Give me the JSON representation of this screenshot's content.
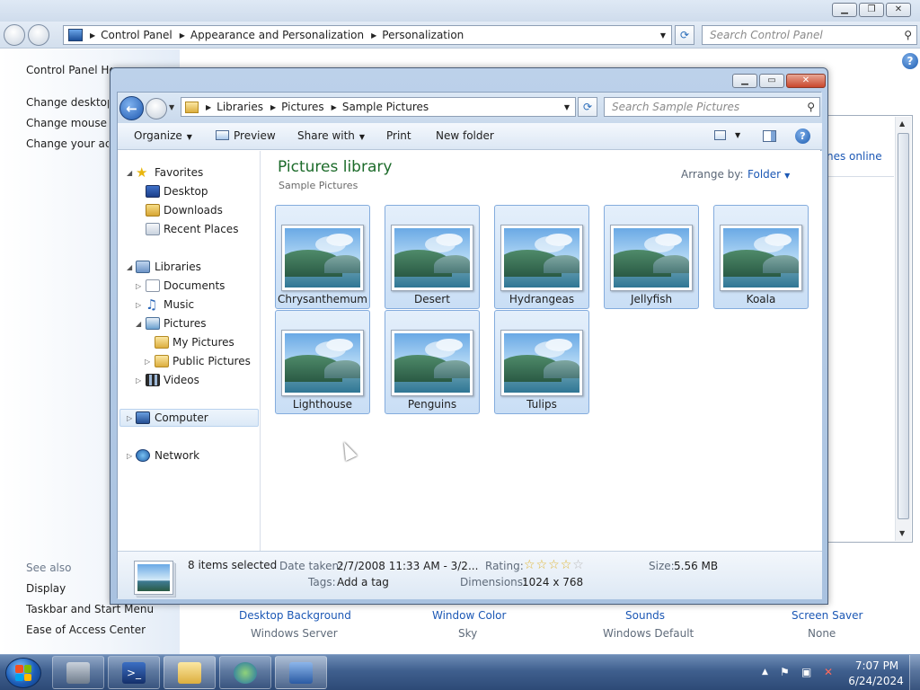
{
  "control_panel": {
    "breadcrumbs": [
      "Control Panel",
      "Appearance and Personalization",
      "Personalization"
    ],
    "search_placeholder": "Search Control Panel",
    "left_links": [
      "Control Panel Home",
      "Change desktop icons",
      "Change mouse pointers",
      "Change your account picture"
    ],
    "see_also_label": "See also",
    "see_also": [
      "Display",
      "Taskbar and Start Menu",
      "Ease of Access Center"
    ],
    "online_link": "nes online",
    "theme_items": [
      {
        "label": "Desktop Background",
        "value": "Windows Server"
      },
      {
        "label": "Window Color",
        "value": "Sky"
      },
      {
        "label": "Sounds",
        "value": "Windows Default"
      },
      {
        "label": "Screen Saver",
        "value": "None"
      }
    ]
  },
  "explorer": {
    "breadcrumbs": [
      "Libraries",
      "Pictures",
      "Sample Pictures"
    ],
    "search_placeholder": "Search Sample Pictures",
    "toolbar": {
      "organize": "Organize",
      "preview": "Preview",
      "share_with": "Share with",
      "print": "Print",
      "new_folder": "New folder"
    },
    "tree": {
      "favorites": {
        "label": "Favorites",
        "items": [
          "Desktop",
          "Downloads",
          "Recent Places"
        ]
      },
      "libraries": {
        "label": "Libraries",
        "items": [
          "Documents",
          "Music",
          "Pictures"
        ]
      },
      "pictures_children": [
        "My Pictures",
        "Public Pictures"
      ],
      "videos": "Videos",
      "computer": "Computer",
      "network": "Network"
    },
    "library_title": "Pictures library",
    "library_subtitle": "Sample Pictures",
    "arrange_by_label": "Arrange by:",
    "arrange_by_value": "Folder",
    "files": [
      "Chrysanthemum",
      "Desert",
      "Hydrangeas",
      "Jellyfish",
      "Koala",
      "Lighthouse",
      "Penguins",
      "Tulips"
    ],
    "details": {
      "selection": "8 items selected",
      "date_taken_label": "Date taken:",
      "date_taken_value": "2/7/2008 11:33 AM - 3/2...",
      "tags_label": "Tags:",
      "tags_value": "Add a tag",
      "rating_label": "Rating:",
      "rating_stars": 0,
      "dimensions_label": "Dimensions:",
      "dimensions_value": "1024 x 768",
      "size_label": "Size:",
      "size_value": "5.56 MB"
    }
  },
  "taskbar": {
    "time": "7:07 PM",
    "date": "6/24/2024"
  },
  "colors": {
    "link": "#1c58b5",
    "library_title": "#1c6b2a",
    "selection": "#c9def5"
  }
}
